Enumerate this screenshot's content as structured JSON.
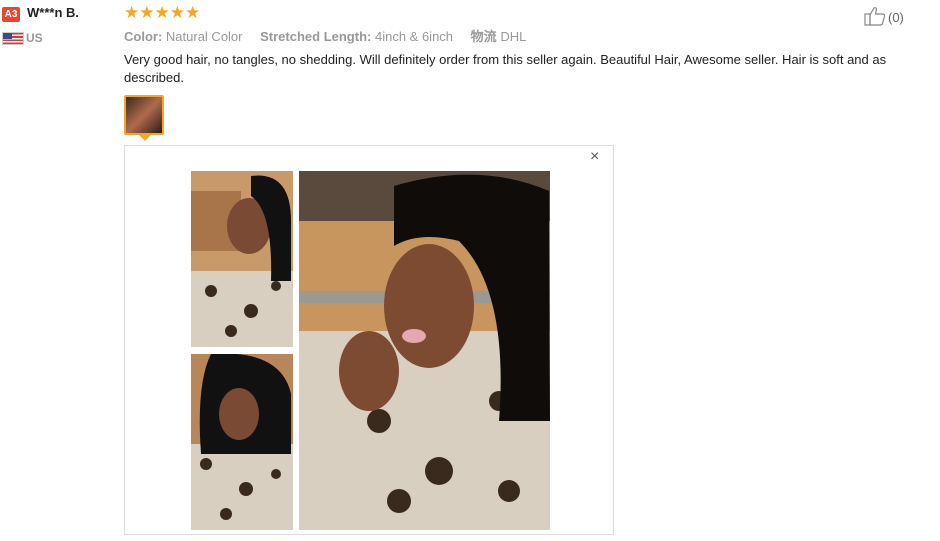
{
  "reviewer": {
    "badge": "A3",
    "name": "W***n B.",
    "country": "US",
    "flag_icon": "us-flag-icon"
  },
  "review": {
    "stars": "★★★★★",
    "rating": 5,
    "color_label": "Color:",
    "color_value": "Natural Color",
    "length_label": "Stretched Length:",
    "length_value": "4inch & 6inch",
    "shipping_label": "物流",
    "shipping_value": "DHL",
    "text": "Very good hair, no tangles, no shedding. Will definitely order from this seller again. Beautiful Hair, Awesome seller. Hair is soft and as described.",
    "helpful_count": "(0)",
    "helpful_icon": "thumbs-up-icon"
  },
  "viewer": {
    "close_label": "×",
    "close_icon": "close-icon"
  },
  "colors": {
    "accent": "#f5a623",
    "badge": "#e8462f"
  }
}
